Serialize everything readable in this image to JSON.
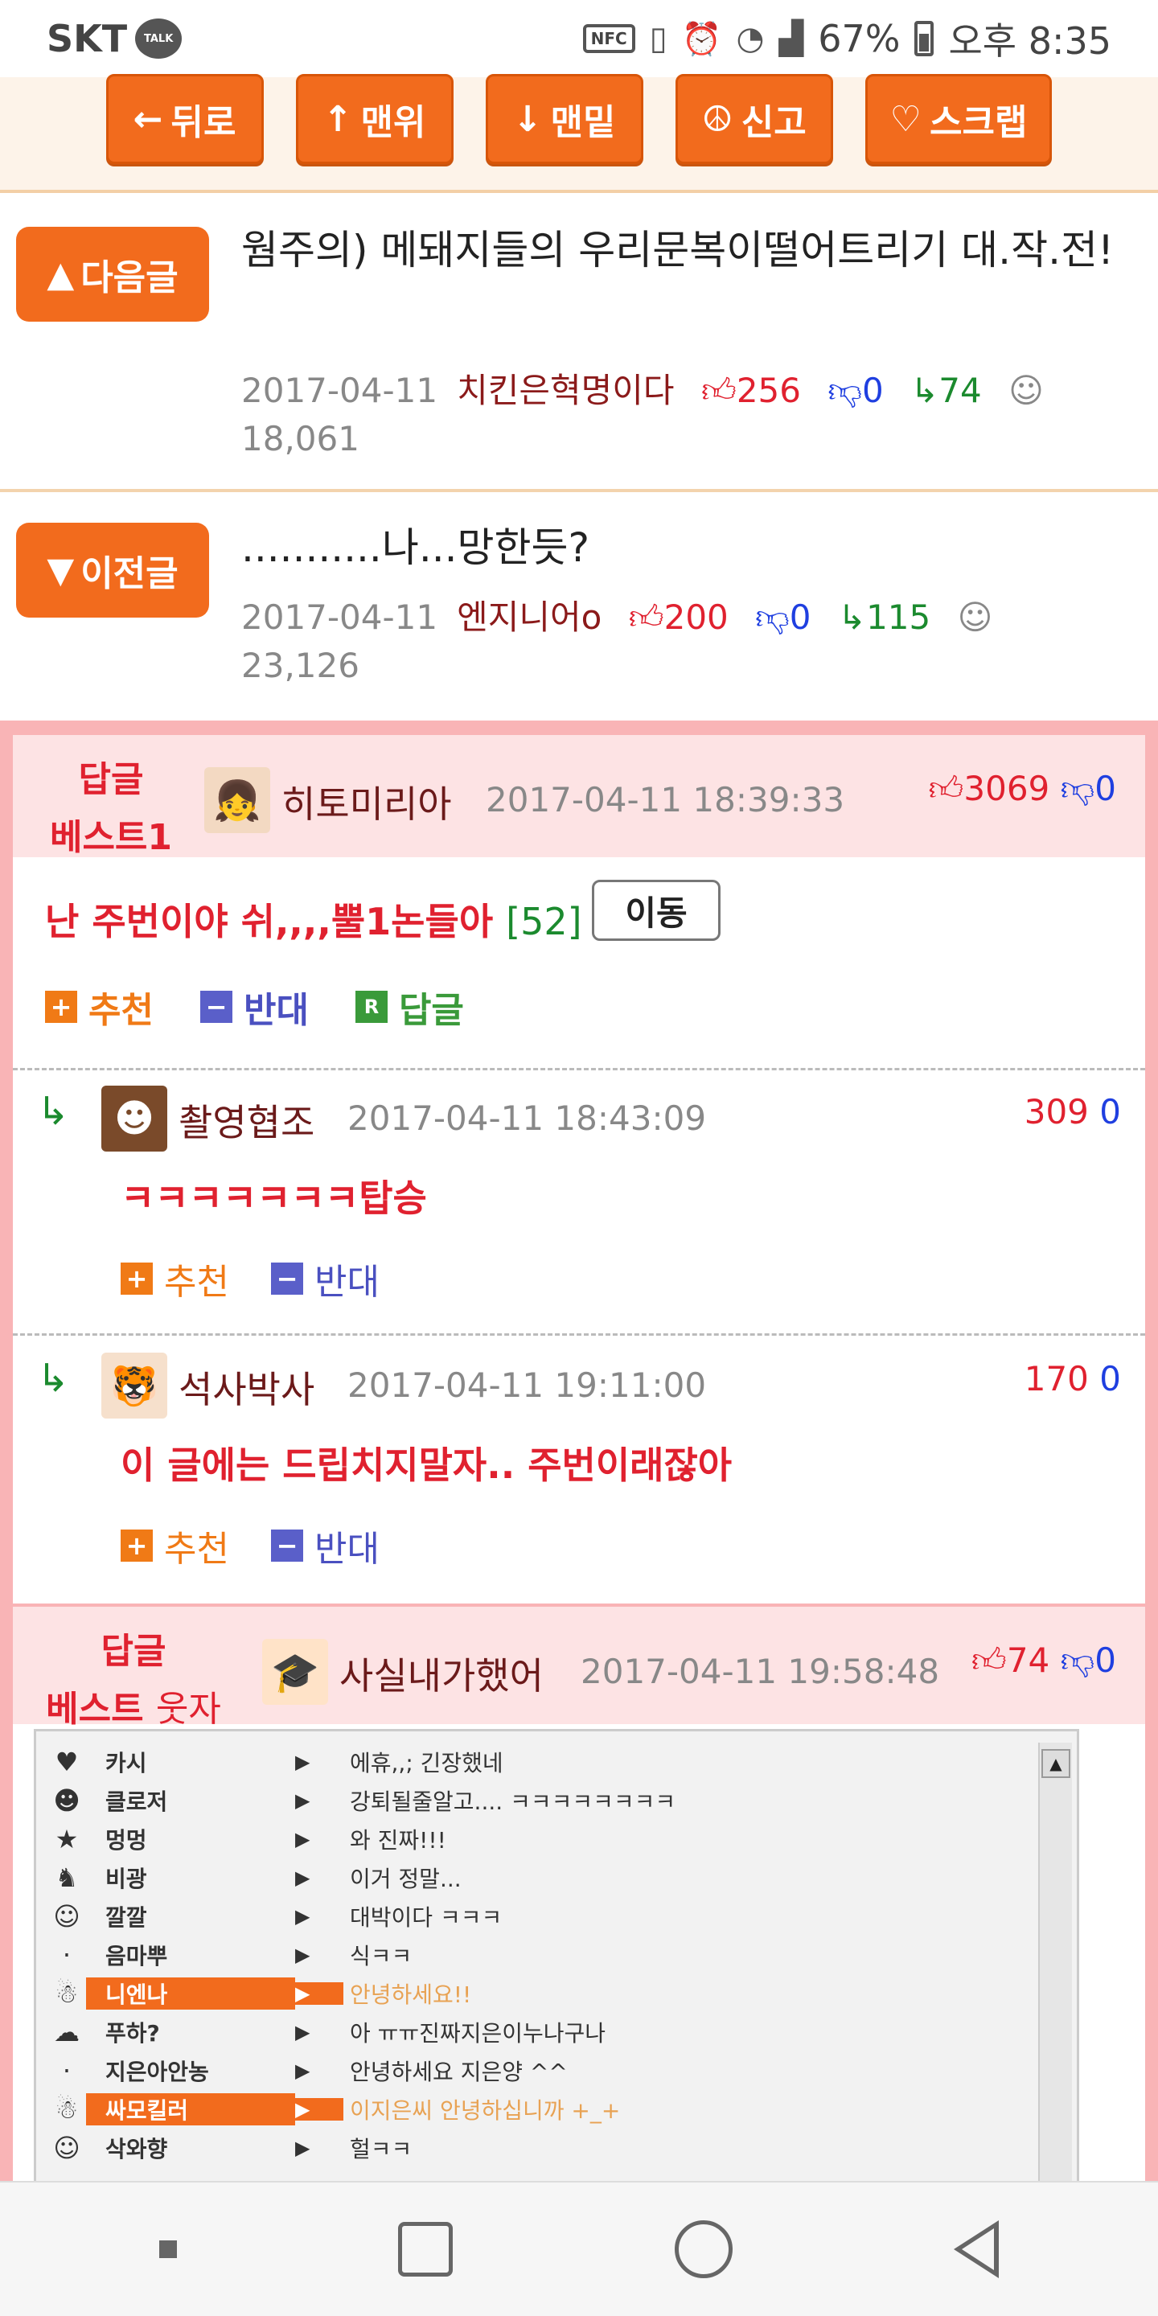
{
  "status_bar": {
    "carrier": "SKT",
    "talk_badge": "TALK",
    "nfc": "NFC",
    "battery": "67%",
    "time": "오후 8:35"
  },
  "top_nav": {
    "back": "뒤로",
    "top": "맨위",
    "bottom": "맨밑",
    "report": "신고",
    "scrap": "스크랩"
  },
  "next_article": {
    "button": "다음글",
    "title": "웜주의) 메돼지들의 우리문복이떨어트리기 대.작.전!",
    "date": "2017-04-11",
    "author": "치킨은혁명이다",
    "up": "256",
    "down": "0",
    "replies": "74",
    "views": "18,061"
  },
  "prev_article": {
    "button": "이전글",
    "title": "...........나...망한듯?",
    "date": "2017-04-11",
    "author": "엔지니어o",
    "up": "200",
    "down": "0",
    "replies": "115",
    "views": "23,126"
  },
  "best1": {
    "label_line1": "답글",
    "label_line2": "베스트1",
    "nick": "히토미리아",
    "date": "2017-04-11 18:39:33",
    "up": "3069",
    "down": "0",
    "text": "난 주번이야 쉬,,,,뿔1논들아",
    "reply_count": "[52]",
    "move": "이동",
    "recommend": "추천",
    "oppose": "반대",
    "reply": "답글"
  },
  "subreplies": [
    {
      "nick": "촬영협조",
      "date": "2017-04-11 18:43:09",
      "up": "309",
      "down": "0",
      "text": "ㅋㅋㅋㅋㅋㅋㅋ탑승",
      "recommend": "추천",
      "oppose": "반대"
    },
    {
      "nick": "석사박사",
      "date": "2017-04-11 19:11:00",
      "up": "170",
      "down": "0",
      "text": "이 글에는 드립치지말자.. 주번이래잖아",
      "recommend": "추천",
      "oppose": "반대"
    }
  ],
  "best_funny": {
    "label_line1": "답글",
    "label_line2a": "베스트",
    "label_line2b": "웃자",
    "nick": "사실내가했어",
    "date": "2017-04-11 19:58:48",
    "up": "74",
    "down": "0"
  },
  "chat_image": {
    "rows": [
      {
        "name": "카시",
        "msg": "에휴,,; 긴장했네",
        "hl": false
      },
      {
        "name": "클로저",
        "msg": "강퇴될줄알고.... ㅋㅋㅋㅋㅋㅋㅋㅋ",
        "hl": false
      },
      {
        "name": "멍멍",
        "msg": "와 진짜!!!",
        "hl": false
      },
      {
        "name": "비광",
        "msg": "이거 정말...",
        "hl": false
      },
      {
        "name": "깔깔",
        "msg": "대박이다 ㅋㅋㅋ",
        "hl": false
      },
      {
        "name": "음마뿌",
        "msg": "식ㅋㅋ",
        "hl": false
      },
      {
        "name": "니엔나",
        "msg": "안녕하세요!!",
        "hl": true
      },
      {
        "name": "푸하?",
        "msg": "아 ㅠㅠ진짜지은이누나구나",
        "hl": false
      },
      {
        "name": "지은아안농",
        "msg": "안녕하세요 지은양 ^^",
        "hl": false
      },
      {
        "name": "싸모킬러",
        "msg": "이지은씨 안녕하십니까 +_+",
        "hl": true
      },
      {
        "name": "삭와향",
        "msg": "헐ㅋㅋ",
        "hl": false
      }
    ]
  },
  "colors": {
    "accent_orange": "#f26b1d",
    "up_red": "#e0212f",
    "down_blue": "#1f3fe0",
    "reply_green": "#1b8a2e",
    "best_bg": "#f9b4b6"
  }
}
